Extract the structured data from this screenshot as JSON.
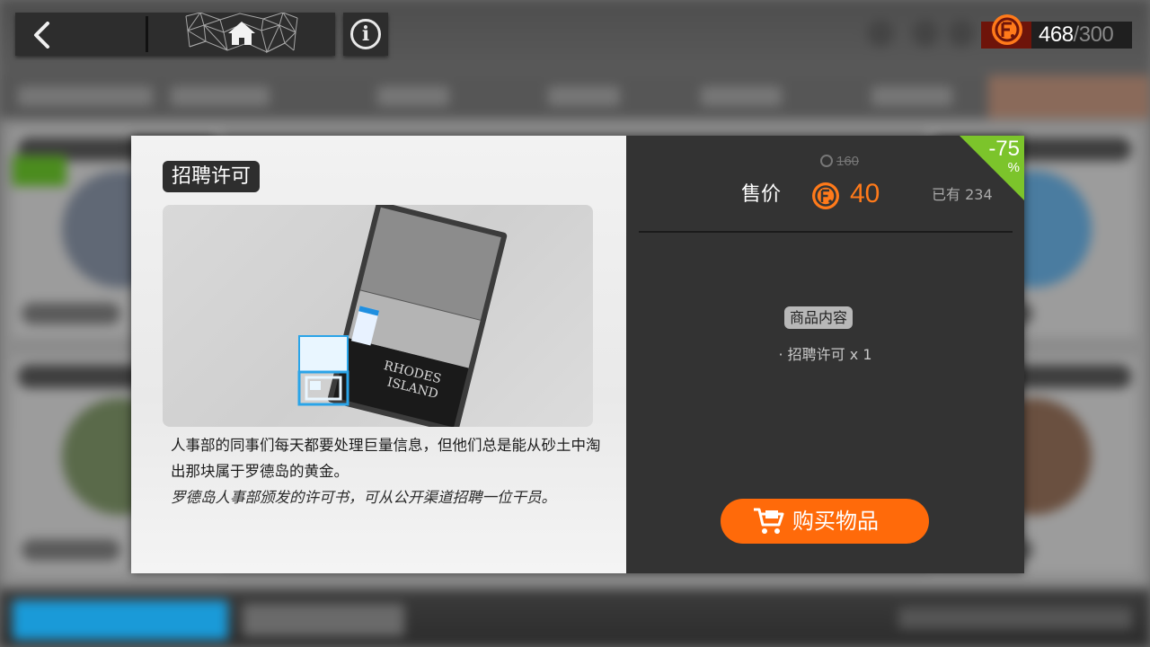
{
  "header": {
    "back_icon": "chevron-left-icon",
    "home_icon": "home-icon",
    "info_icon": "info-icon",
    "info_label": "i",
    "currency": {
      "icon": "commendation-coin-icon",
      "current": "468",
      "separator": "/",
      "max": "300"
    }
  },
  "item": {
    "name": "招聘许可",
    "image_icon": "recruitment-permit-icon",
    "art_text": [
      "RHODES",
      "ISLAND"
    ],
    "description": "人事部的同事们每天都要处理巨量信息，但他们总是能从砂土中淘出那块属于罗德岛的黄金。",
    "flavor_text": "罗德岛人事部颁发的许可书，可从公开渠道招聘一位干员。"
  },
  "pricing": {
    "discount": "-75",
    "discount_sign": "%",
    "original_price": "160",
    "price_label": "售价",
    "price": "40",
    "owned": "已有 234"
  },
  "contents": {
    "title": "商品内容",
    "items": [
      "· 招聘许可 x 1"
    ]
  },
  "buy_button": {
    "label": "购买物品",
    "icon": "shopping-cart-icon"
  },
  "colors": {
    "accent_orange": "#ff6a0a",
    "price_orange": "#ff7a1a",
    "discount_green": "#7cc42b",
    "panel_dark": "#333333",
    "panel_light": "#eeeeee"
  }
}
